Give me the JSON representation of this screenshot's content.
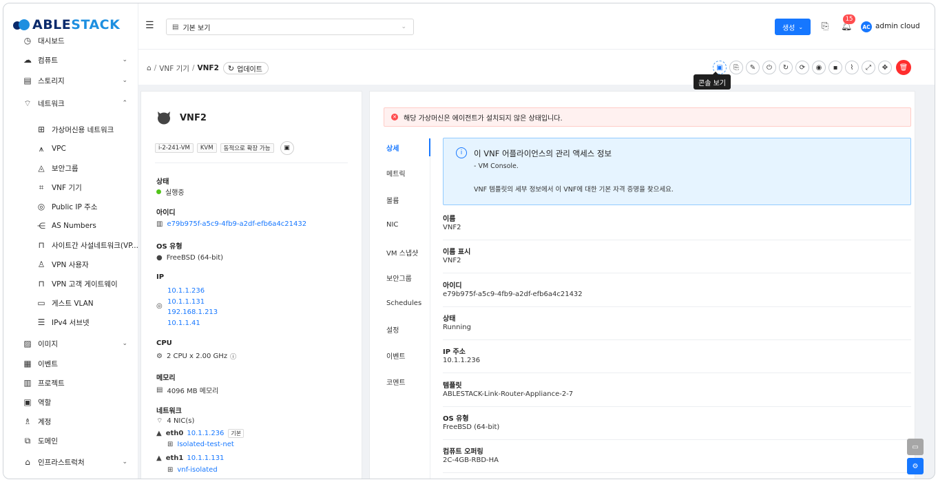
{
  "brand": {
    "part1": "ABLE",
    "part2": "STACK"
  },
  "sidebar": {
    "items": [
      {
        "label": "대시보드",
        "icon": "dashboard-icon",
        "glyph": "◷"
      },
      {
        "label": "컴퓨트",
        "icon": "cloud-icon",
        "glyph": "☁"
      },
      {
        "label": "스토리지",
        "icon": "database-icon",
        "glyph": "▤"
      },
      {
        "label": "네트워크",
        "icon": "wifi-icon",
        "glyph": "⌔"
      },
      {
        "label": "가상머신용 네트워크",
        "icon": "cluster-icon",
        "glyph": "⊞"
      },
      {
        "label": "VPC",
        "icon": "deployment-icon",
        "glyph": "⩚"
      },
      {
        "label": "보안그룹",
        "icon": "fire-icon",
        "glyph": "◬"
      },
      {
        "label": "VNF 기기",
        "icon": "gateway-icon",
        "glyph": "⌗"
      },
      {
        "label": "Public IP 주소",
        "icon": "environment-icon",
        "glyph": "◎"
      },
      {
        "label": "AS Numbers",
        "icon": "partition-icon",
        "glyph": "⋲"
      },
      {
        "label": "사이트간 사설네트워크(VP...",
        "icon": "lock-icon",
        "glyph": "⊓"
      },
      {
        "label": "VPN 사용자",
        "icon": "user-icon",
        "glyph": "♙"
      },
      {
        "label": "VPN 고객 게이트웨이",
        "icon": "lock-icon",
        "glyph": "⊓"
      },
      {
        "label": "게스트 VLAN",
        "icon": "folder-icon",
        "glyph": "▭"
      },
      {
        "label": "IPv4 서브넷",
        "icon": "subnet-icon",
        "glyph": "☰"
      },
      {
        "label": "이미지",
        "icon": "picture-icon",
        "glyph": "▨"
      },
      {
        "label": "이벤트",
        "icon": "schedule-icon",
        "glyph": "▦"
      },
      {
        "label": "프로젝트",
        "icon": "project-icon",
        "glyph": "▥"
      },
      {
        "label": "역할",
        "icon": "idcard-icon",
        "glyph": "▣"
      },
      {
        "label": "계정",
        "icon": "team-icon",
        "glyph": "♗"
      },
      {
        "label": "도메인",
        "icon": "block-icon",
        "glyph": "⧉"
      },
      {
        "label": "인프라스트럭처",
        "icon": "bank-icon",
        "glyph": "⌂"
      }
    ]
  },
  "topbar": {
    "menu_icon": "☰",
    "view_select": "기본 보기",
    "view_icon": "▤",
    "create_label": "생성",
    "notification_count": "15",
    "avatar": "AC",
    "user": "admin cloud"
  },
  "breadcrumb": {
    "home": "⌂",
    "parent": "VNF 기기",
    "current": "VNF2",
    "refresh": "업데이트"
  },
  "actions": {
    "tooltip": "콘솔 보기",
    "buttons": [
      {
        "name": "console-icon",
        "glyph": "▣"
      },
      {
        "name": "copy-icon",
        "glyph": "⎘"
      },
      {
        "name": "edit-icon",
        "glyph": "✎"
      },
      {
        "name": "power-icon",
        "glyph": "⏻"
      },
      {
        "name": "reboot-icon",
        "glyph": "↻"
      },
      {
        "name": "sync-icon",
        "glyph": "⟳"
      },
      {
        "name": "camera-icon",
        "glyph": "◉"
      },
      {
        "name": "snapshot-icon",
        "glyph": "▪"
      },
      {
        "name": "paperclip-icon",
        "glyph": "⌇"
      },
      {
        "name": "expand-icon",
        "glyph": "⤢"
      },
      {
        "name": "drag-icon",
        "glyph": "✥"
      },
      {
        "name": "delete-icon",
        "glyph": "🗑"
      }
    ]
  },
  "vm": {
    "name": "VNF2",
    "tags": [
      "i-2-241-VM",
      "KVM",
      "동적으로 확장 가능"
    ],
    "state_label": "상태",
    "state": "실행중",
    "id_label": "아이디",
    "id": "e79b975f-a5c9-4fb9-a2df-efb6a4c21432",
    "os_label": "OS 유형",
    "os": "FreeBSD (64-bit)",
    "ip_label": "IP",
    "ips": [
      "10.1.1.236",
      "10.1.1.131",
      "192.168.1.213",
      "10.1.1.41"
    ],
    "cpu_label": "CPU",
    "cpu": "2 CPU x 2.00 GHz",
    "mem_label": "메모리",
    "mem": "4096 MB 메모리",
    "net_label": "네트워크",
    "nic_count": "4 NIC(s)",
    "nics": [
      {
        "name": "eth0",
        "ip": "10.1.1.236",
        "tag": "기본",
        "network": "Isolated-test-net"
      },
      {
        "name": "eth1",
        "ip": "10.1.1.131",
        "tag": "",
        "network": "vnf-isolated"
      }
    ]
  },
  "alert": "해당 가상머신은 에이전트가 설치되지 않은 상태입니다.",
  "tabs": [
    "상세",
    "메트릭",
    "볼륨",
    "NIC",
    "VM 스냅샷",
    "보안그룹",
    "Schedules",
    "설정",
    "이벤트",
    "코멘트"
  ],
  "info": {
    "title": "이 VNF 어플라이언스의 관리 액세스 정보",
    "line1": "- VM Console.",
    "line2": "VNF 템플릿의 세부 정보에서 이 VNF에 대한 기본 자격 증명을 찾으세요."
  },
  "details": [
    {
      "label": "이름",
      "value": "VNF2"
    },
    {
      "label": "이름 표시",
      "value": "VNF2"
    },
    {
      "label": "아이디",
      "value": "e79b975f-a5c9-4fb9-a2df-efb6a4c21432"
    },
    {
      "label": "상태",
      "value": "Running"
    },
    {
      "label": "IP 주소",
      "value": "10.1.1.236"
    },
    {
      "label": "템플릿",
      "value": "ABLESTACK-Link-Router-Appliance-2-7"
    },
    {
      "label": "OS 유형",
      "value": "FreeBSD (64-bit)"
    },
    {
      "label": "컴퓨트 오퍼링",
      "value": "2C-4GB-RBD-HA"
    }
  ],
  "colors": {
    "primary": "#1677ff",
    "danger": "#ff4d4f",
    "success": "#52c41a"
  }
}
